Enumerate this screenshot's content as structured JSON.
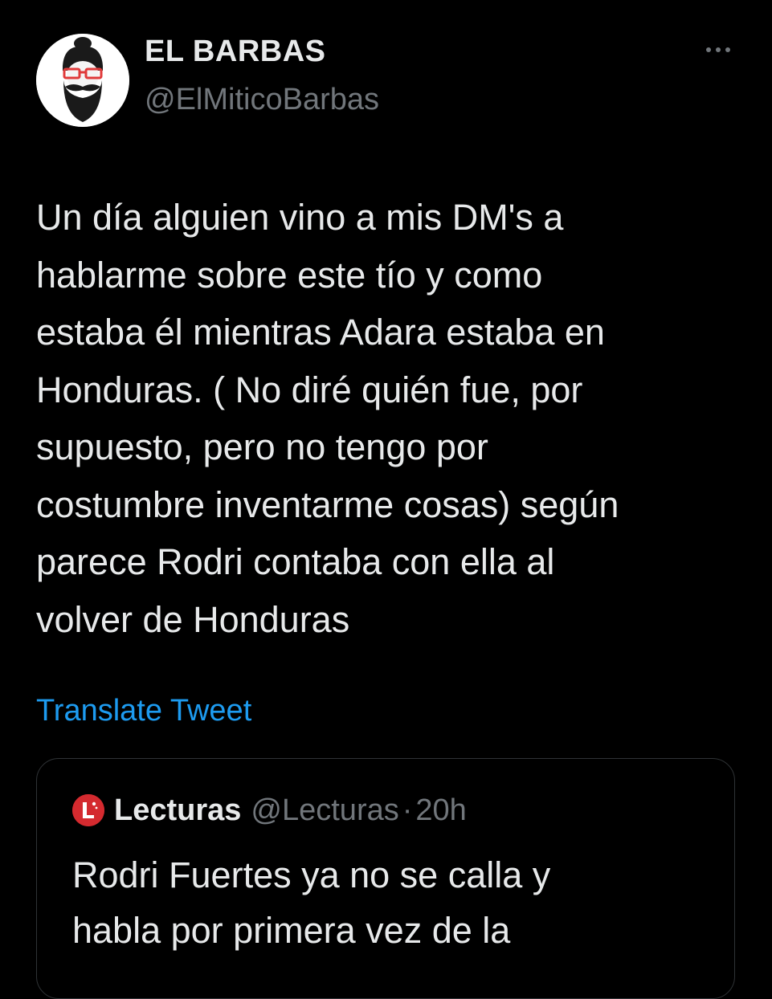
{
  "author": {
    "display_name": "EL BARBAS",
    "handle": "@ElMiticoBarbas",
    "avatar_icon": "bearded-man-glasses-avatar"
  },
  "more_icon": "ellipsis-icon",
  "tweet": {
    "text": "Un día alguien vino a mis DM's a\nhablarme sobre este tío y como\nestaba él mientras Adara estaba en\nHonduras. ( No diré quién fue, por\nsupuesto, pero no tengo por\ncostumbre inventarme cosas) según\nparece Rodri contaba con ella al\nvolver de Honduras",
    "translate_label": "Translate Tweet"
  },
  "quoted_tweet": {
    "logo_icon": "lecturas-logo-icon",
    "name": "Lecturas",
    "handle": "@Lecturas",
    "separator": "·",
    "time": "20h",
    "text": "Rodri Fuertes ya no se calla y\nhabla por primera vez de la"
  },
  "colors": {
    "background": "#000000",
    "text": "#e7e9ea",
    "muted": "#71767b",
    "link": "#1d9bf0",
    "border": "#2f3336",
    "lecturas_red": "#d42a2f"
  }
}
